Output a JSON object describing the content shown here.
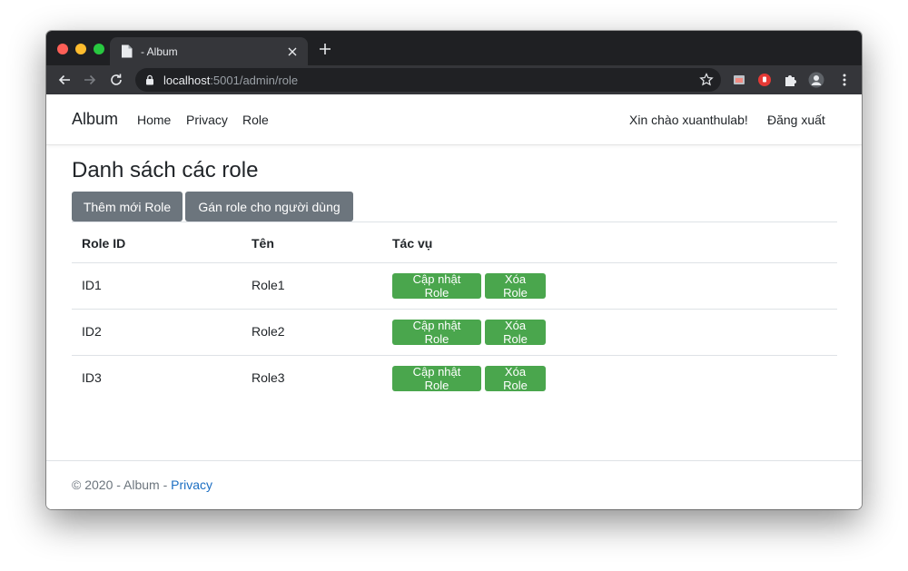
{
  "browser": {
    "tab_title": "- Album",
    "url_host": "localhost",
    "url_rest": ":5001/admin/role"
  },
  "navbar": {
    "brand": "Album",
    "links": [
      "Home",
      "Privacy",
      "Role"
    ],
    "greeting": "Xin chào xuanthulab!",
    "logout": "Đăng xuất"
  },
  "main": {
    "heading": "Danh sách các role",
    "add_button": "Thêm mới Role",
    "assign_button": "Gán role cho người dùng",
    "table": {
      "headers": [
        "Role ID",
        "Tên",
        "Tác vụ"
      ],
      "rows": [
        {
          "id": "ID1",
          "name": "Role1",
          "update": "Cập nhật Role",
          "delete": "Xóa Role"
        },
        {
          "id": "ID2",
          "name": "Role2",
          "update": "Cập nhật Role",
          "delete": "Xóa Role"
        },
        {
          "id": "ID3",
          "name": "Role3",
          "update": "Cập nhật Role",
          "delete": "Xóa Role"
        }
      ]
    }
  },
  "footer": {
    "text": "© 2020 - Album - ",
    "link": "Privacy"
  },
  "colors": {
    "button_gray": "#6c757d",
    "button_green": "#4aa64d",
    "link_blue": "#1b6ec2"
  }
}
